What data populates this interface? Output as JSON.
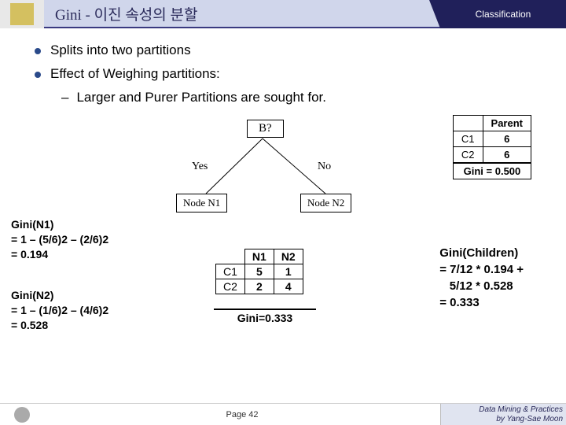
{
  "header": {
    "title": "Gini - 이진 속성의 분할",
    "right": "Classification"
  },
  "bullets": {
    "b1": "Splits into two partitions",
    "b2": "Effect of Weighing partitions:",
    "sub": "Larger and Purer Partitions are sought for."
  },
  "tree": {
    "root": "B?",
    "yes": "Yes",
    "no": "No",
    "n1": "Node N1",
    "n2": "Node N2"
  },
  "parent": {
    "head": "Parent",
    "r1c1": "C1",
    "r1c2": "6",
    "r2c1": "C2",
    "r2c2": "6",
    "gini": "Gini = 0.500"
  },
  "gini_n1": {
    "l1": "Gini(N1)",
    "l2": "= 1 – (5/6)2 – (2/6)2",
    "l3": "= 0.194"
  },
  "gini_n2": {
    "l1": "Gini(N2)",
    "l2": "= 1 – (1/6)2 – (4/6)2",
    "l3": "= 0.528"
  },
  "n1n2": {
    "h1": "N1",
    "h2": "N2",
    "r1c1": "C1",
    "r1c2": "5",
    "r1c3": "1",
    "r2c1": "C2",
    "r2c2": "2",
    "r2c3": "4",
    "gini": "Gini=0.333"
  },
  "gini_children": {
    "l1": "Gini(Children)",
    "l2": "= 7/12 * 0.194 +",
    "l3": "   5/12 * 0.528",
    "l4": "= 0.333"
  },
  "footer": {
    "page": "Page 42",
    "credit1": "Data Mining & Practices",
    "credit2": "by Yang-Sae Moon"
  },
  "chart_data": {
    "type": "table",
    "description": "Gini index computation for binary attribute split",
    "parent": {
      "C1": 6,
      "C2": 6,
      "gini": 0.5
    },
    "split": {
      "attribute": "B",
      "nodes": {
        "N1": {
          "branch": "Yes",
          "C1": 5,
          "C2": 2,
          "gini": 0.194
        },
        "N2": {
          "branch": "No",
          "C1": 1,
          "C2": 4,
          "gini": 0.528
        }
      },
      "weighted_gini": 0.333,
      "weights": {
        "N1": "7/12",
        "N2": "5/12"
      }
    }
  }
}
